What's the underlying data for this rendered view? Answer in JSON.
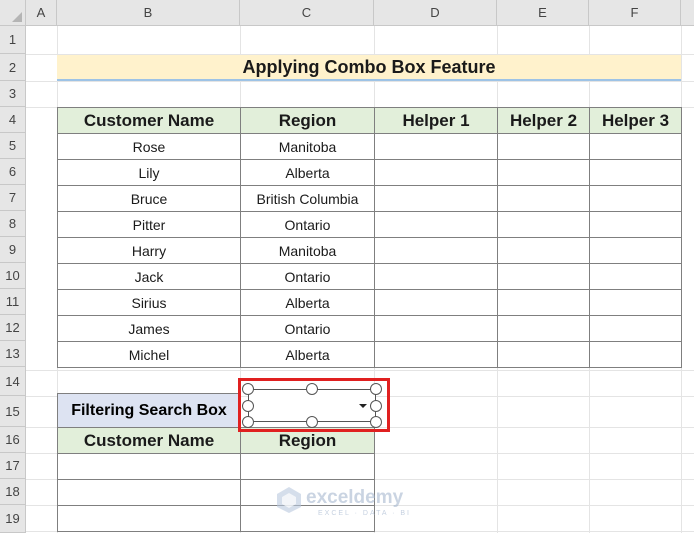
{
  "columns": [
    "A",
    "B",
    "C",
    "D",
    "E",
    "F"
  ],
  "rows": [
    "1",
    "2",
    "3",
    "4",
    "5",
    "6",
    "7",
    "8",
    "9",
    "10",
    "11",
    "12",
    "13",
    "14",
    "15",
    "16",
    "17",
    "18",
    "19"
  ],
  "title": "Applying Combo Box Feature",
  "table": {
    "headers": [
      "Customer Name",
      "Region",
      "Helper 1",
      "Helper 2",
      "Helper 3"
    ],
    "rows": [
      [
        "Rose",
        "Manitoba"
      ],
      [
        "Lily",
        "Alberta"
      ],
      [
        "Bruce",
        "British Columbia"
      ],
      [
        "Pitter",
        "Ontario"
      ],
      [
        "Harry",
        "Manitoba"
      ],
      [
        "Jack",
        "Ontario"
      ],
      [
        "Sirius",
        "Alberta"
      ],
      [
        "James",
        "Ontario"
      ],
      [
        "Michel",
        "Alberta"
      ]
    ]
  },
  "filter": {
    "label": "Filtering Search Box",
    "combo_value": "",
    "result_headers": [
      "Customer Name",
      "Region"
    ]
  },
  "watermark": {
    "name": "exceldemy",
    "tagline": "EXCEL · DATA · BI"
  }
}
